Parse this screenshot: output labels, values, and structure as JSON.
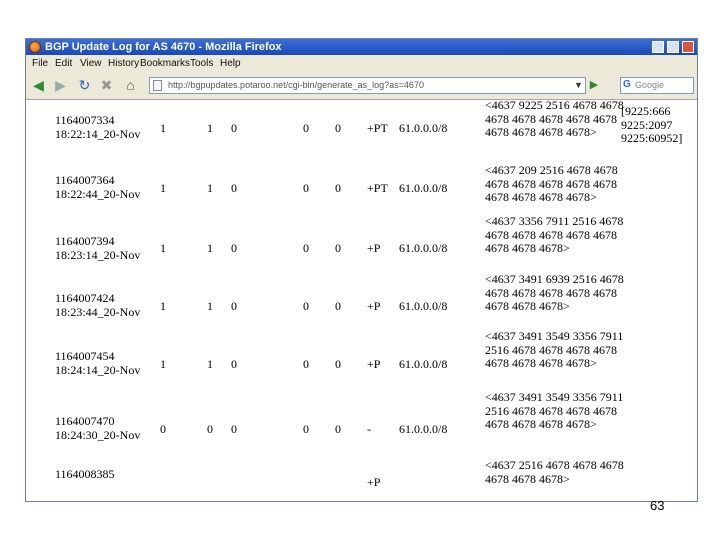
{
  "window": {
    "title": "BGP Update Log for AS 4670 - Mozilla Firefox"
  },
  "menu": [
    "File",
    "Edit",
    "View",
    "History",
    "Bookmarks",
    "Tools",
    "Help"
  ],
  "nav": {
    "url": "http://bgpupdates.potaroo.net/cgi-bin/generate_as_log?as=4670",
    "search_placeholder": "Google"
  },
  "table": {
    "rows": [
      {
        "time": "1164007334",
        "date": "18:22:14_20-Nov",
        "c1": "1",
        "c2": "1",
        "c3": "0",
        "c4": "0",
        "c5": "0",
        "flag": "+PT",
        "prefix": "61.0.0.0/8",
        "path": "<4637 9225 2516 4678 4678 4678 4678 4678 4678 4678 4678 4678 4678 4678>"
      },
      {
        "time": "1164007364",
        "date": "18:22:44_20-Nov",
        "c1": "1",
        "c2": "1",
        "c3": "0",
        "c4": "0",
        "c5": "0",
        "flag": "+PT",
        "prefix": "61.0.0.0/8",
        "path": "<4637 209 2516 4678 4678 4678 4678 4678 4678 4678 4678 4678 4678 4678>"
      },
      {
        "time": "1164007394",
        "date": "18:23:14_20-Nov",
        "c1": "1",
        "c2": "1",
        "c3": "0",
        "c4": "0",
        "c5": "0",
        "flag": "+P",
        "prefix": "61.0.0.0/8",
        "path": "<4637 3356 7911 2516 4678 4678 4678 4678 4678 4678 4678 4678 4678>"
      },
      {
        "time": "1164007424",
        "date": "18:23:44_20-Nov",
        "c1": "1",
        "c2": "1",
        "c3": "0",
        "c4": "0",
        "c5": "0",
        "flag": "+P",
        "prefix": "61.0.0.0/8",
        "path": "<4637 3491 6939 2516 4678 4678 4678 4678 4678 4678 4678 4678 4678>"
      },
      {
        "time": "1164007454",
        "date": "18:24:14_20-Nov",
        "c1": "1",
        "c2": "1",
        "c3": "0",
        "c4": "0",
        "c5": "0",
        "flag": "+P",
        "prefix": "61.0.0.0/8",
        "path": "<4637 3491 3549 3356 7911 2516 4678 4678 4678 4678 4678 4678 4678 4678>"
      },
      {
        "time": "1164007470",
        "date": "18:24:30_20-Nov",
        "c1": "0",
        "c2": "0",
        "c3": "0",
        "c4": "0",
        "c5": "0",
        "flag": "-",
        "prefix": "61.0.0.0/8",
        "path": "<4637 3491 3549 3356 7911 2516 4678 4678 4678 4678 4678 4678 4678 4678>"
      },
      {
        "time": "1164008385",
        "date": "",
        "c1": "",
        "c2": "",
        "c3": "",
        "c4": "",
        "c5": "",
        "flag": "+P",
        "prefix": "",
        "path": "<4637 2516 4678 4678 4678 4678 4678 4678>"
      }
    ],
    "note": "[9225:666 9225:2097 9225:60952]"
  },
  "slide": {
    "page_number": "63"
  }
}
